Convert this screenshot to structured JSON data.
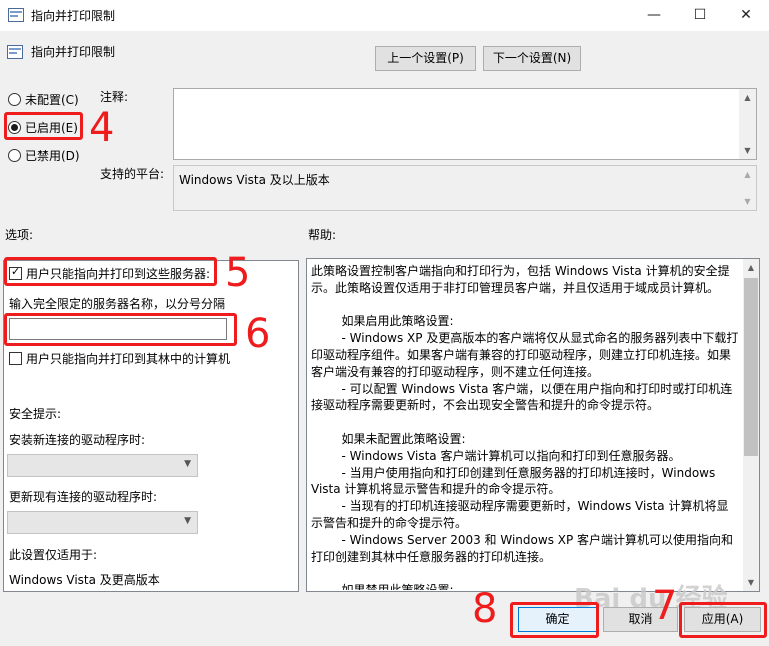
{
  "window": {
    "title": "指向并打印限制",
    "minimize": "—",
    "maximize": "☐",
    "close": "✕"
  },
  "header": {
    "policy_name": "指向并打印限制",
    "prev_button": "上一个设置(P)",
    "next_button": "下一个设置(N)"
  },
  "state": {
    "not_configured": "未配置(C)",
    "enabled": "已启用(E)",
    "disabled": "已禁用(D)",
    "selected": "enabled"
  },
  "comment": {
    "label": "注释:",
    "value": ""
  },
  "platform": {
    "label": "支持的平台:",
    "value": "Windows Vista 及以上版本"
  },
  "options": {
    "label": "选项:",
    "only_servers_label": "用户只能指向并打印到这些服务器:",
    "only_servers_checked": true,
    "servers_field_label": "输入完全限定的服务器名称，以分号分隔",
    "servers_value": "",
    "forest_label": "用户只能指向并打印到其林中的计算机",
    "forest_checked": false,
    "security_label": "安全提示:",
    "new_conn_label": "安装新连接的驱动程序时:",
    "new_conn_value": "",
    "update_conn_label": "更新现有连接的驱动程序时:",
    "update_conn_value": "",
    "applies_label": "此设置仅适用于:",
    "applies_value": "Windows Vista 及更高版本"
  },
  "help": {
    "label": "帮助:",
    "text": "此策略设置控制客户端指向和打印行为，包括 Windows Vista 计算机的安全提示。此策略设置仅适用于非打印管理员客户端，并且仅适用于域成员计算机。\n\n        如果启用此策略设置:\n        - Windows XP 及更高版本的客户端将仅从显式命名的服务器列表中下载打印驱动程序组件。如果客户端有兼容的打印驱动程序，则建立打印机连接。如果客户端没有兼容的打印驱动程序，则不建立任何连接。\n        - 可以配置 Windows Vista 客户端，以便在用户指向和打印时或打印机连接驱动程序需要更新时，不会出现安全警告和提升的命令提示符。\n\n        如果未配置此策略设置:\n        - Windows Vista 客户端计算机可以指向和打印到任意服务器。\n        - 当用户使用指向和打印创建到任意服务器的打印机连接时，Windows Vista 计算机将显示警告和提升的命令提示符。\n        - 当现有的打印机连接驱动程序需要更新时，Windows Vista 计算机将显示警告和提升的命令提示符。\n        - Windows Server 2003 和 Windows XP 客户端计算机可以使用指向和打印创建到其林中任意服务器的打印机连接。\n\n        如果禁用此策略设置:"
  },
  "footer": {
    "ok": "确定",
    "cancel": "取消",
    "apply": "应用(A)"
  },
  "annotations": {
    "n4": "4",
    "n5": "5",
    "n6": "6",
    "n7": "7",
    "n8": "8",
    "color": "#ee1c1c"
  },
  "watermark": "Bai du 经验"
}
